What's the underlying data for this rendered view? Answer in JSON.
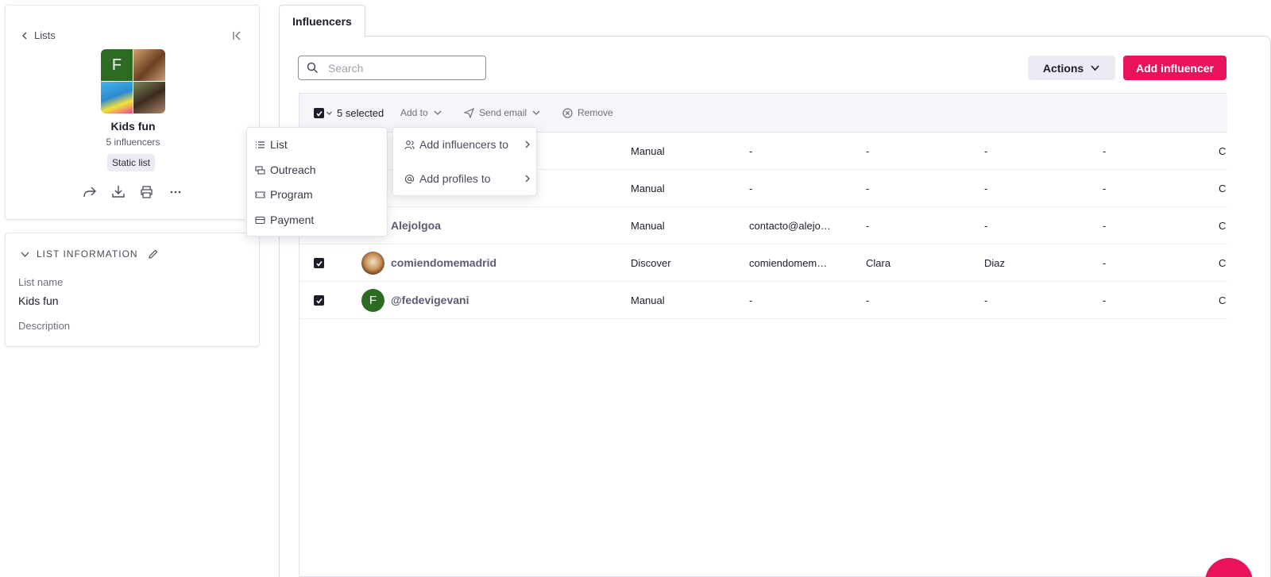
{
  "sidebar": {
    "back_label": "Lists",
    "list_title": "Kids fun",
    "list_count": "5 influencers",
    "list_type_badge": "Static list",
    "avatar_initial": "F",
    "info_header": "LIST INFORMATION",
    "list_name_label": "List name",
    "list_name_value": "Kids fun",
    "description_label": "Description"
  },
  "tabs": [
    {
      "label": "Influencers"
    }
  ],
  "search": {
    "placeholder": "Search"
  },
  "header": {
    "actions_label": "Actions",
    "add_label": "Add influencer"
  },
  "toolbar": {
    "selected": "5 selected",
    "add_to": "Add to",
    "send_email": "Send email",
    "remove": "Remove"
  },
  "add_to_menu": {
    "items": [
      {
        "label": "List"
      },
      {
        "label": "Outreach"
      },
      {
        "label": "Program"
      },
      {
        "label": "Payment"
      }
    ]
  },
  "submenu": {
    "items": [
      {
        "label": "Add influencers to"
      },
      {
        "label": "Add profiles to"
      }
    ]
  },
  "rows": [
    {
      "name": "",
      "source": "Manual",
      "email": "-",
      "first": "-",
      "last": "-",
      "extra": "-",
      "more": "C"
    },
    {
      "name": "",
      "source": "Manual",
      "email": "-",
      "first": "-",
      "last": "-",
      "extra": "-",
      "more": "C"
    },
    {
      "name": "Alejolgoa",
      "source": "Manual",
      "email": "contacto@alejo…",
      "first": "-",
      "last": "-",
      "extra": "-",
      "more": "C"
    },
    {
      "name": "comiendomemadrid",
      "source": "Discover",
      "email": "comiendomem…",
      "first": "Clara",
      "last": "Diaz",
      "extra": "-",
      "more": "C"
    },
    {
      "name": "@fedevigevani",
      "source": "Manual",
      "email": "-",
      "first": "-",
      "last": "-",
      "extra": "-",
      "more": "C",
      "initial": "F"
    }
  ],
  "colors": {
    "accent": "#e8135c",
    "avatar_green": "#2d6b22"
  }
}
